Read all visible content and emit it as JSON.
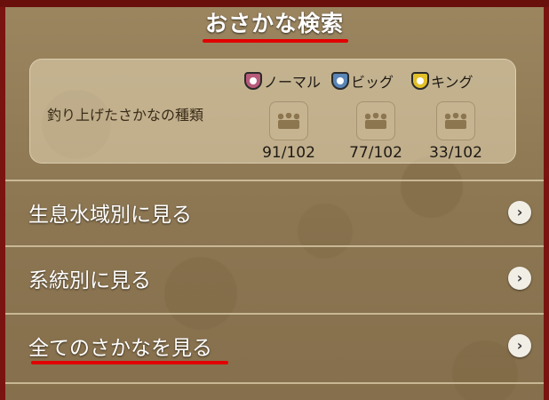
{
  "header": {
    "title": "おさかな検索"
  },
  "summary": {
    "label": "釣り上げたさかなの種類",
    "categories": [
      {
        "name": "ノーマル",
        "count": "91/102",
        "color": "#b85a7a"
      },
      {
        "name": "ビッグ",
        "count": "77/102",
        "color": "#5a86b8"
      },
      {
        "name": "キング",
        "count": "33/102",
        "color": "#e2c028"
      }
    ]
  },
  "menu": {
    "items": [
      {
        "label": "生息水域別に見る"
      },
      {
        "label": "系統別に見る"
      },
      {
        "label": "全てのさかなを見る"
      }
    ]
  },
  "colors": {
    "accent_red": "#e00000",
    "frame": "#7a1410"
  }
}
